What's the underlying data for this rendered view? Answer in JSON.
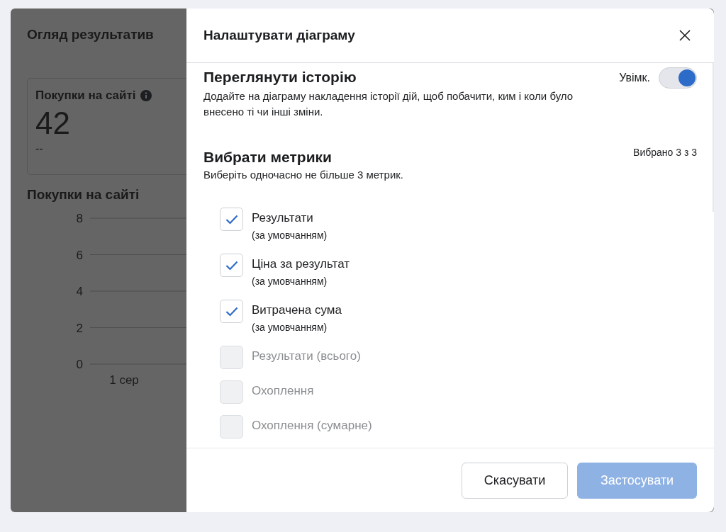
{
  "background": {
    "title": "Огляд результатив",
    "metric_card": {
      "label": "Покупки на сайті",
      "value": "42",
      "change": "--"
    },
    "chart_title": "Покупки на сайті",
    "chart_data": {
      "type": "line",
      "grid": true,
      "categories": [
        "1 сер"
      ],
      "ylim": [
        0,
        8
      ],
      "yticks": [
        0,
        2,
        4,
        6,
        8
      ]
    }
  },
  "dialog": {
    "title": "Налаштувати діаграму",
    "history": {
      "title": "Переглянути історію",
      "description": "Додайте на діаграму накладення історії дій, щоб побачити, ким і коли було внесено ті чи інші зміни.",
      "toggle_label": "Увімк.",
      "on": true
    },
    "metrics": {
      "title": "Вибрати метрики",
      "count": "Вибрано 3 з 3",
      "hint": "Виберіть одночасно не більше 3 метрик.",
      "items": [
        {
          "label": "Результати",
          "note": "(за умовчанням)",
          "checked": true,
          "disabled": false
        },
        {
          "label": "Ціна за результат",
          "note": "(за умовчанням)",
          "checked": true,
          "disabled": false
        },
        {
          "label": "Витрачена сума",
          "note": "(за умовчанням)",
          "checked": true,
          "disabled": false
        },
        {
          "label": "Результати (всього)",
          "checked": false,
          "disabled": true
        },
        {
          "label": "Охоплення",
          "checked": false,
          "disabled": true
        },
        {
          "label": "Охоплення (сумарне)",
          "checked": false,
          "disabled": true
        }
      ]
    },
    "buttons": [
      {
        "label": "Скасувати",
        "kind": "secondary",
        "disabled": false
      },
      {
        "label": "Застосувати",
        "kind": "primary",
        "disabled": true
      }
    ]
  }
}
